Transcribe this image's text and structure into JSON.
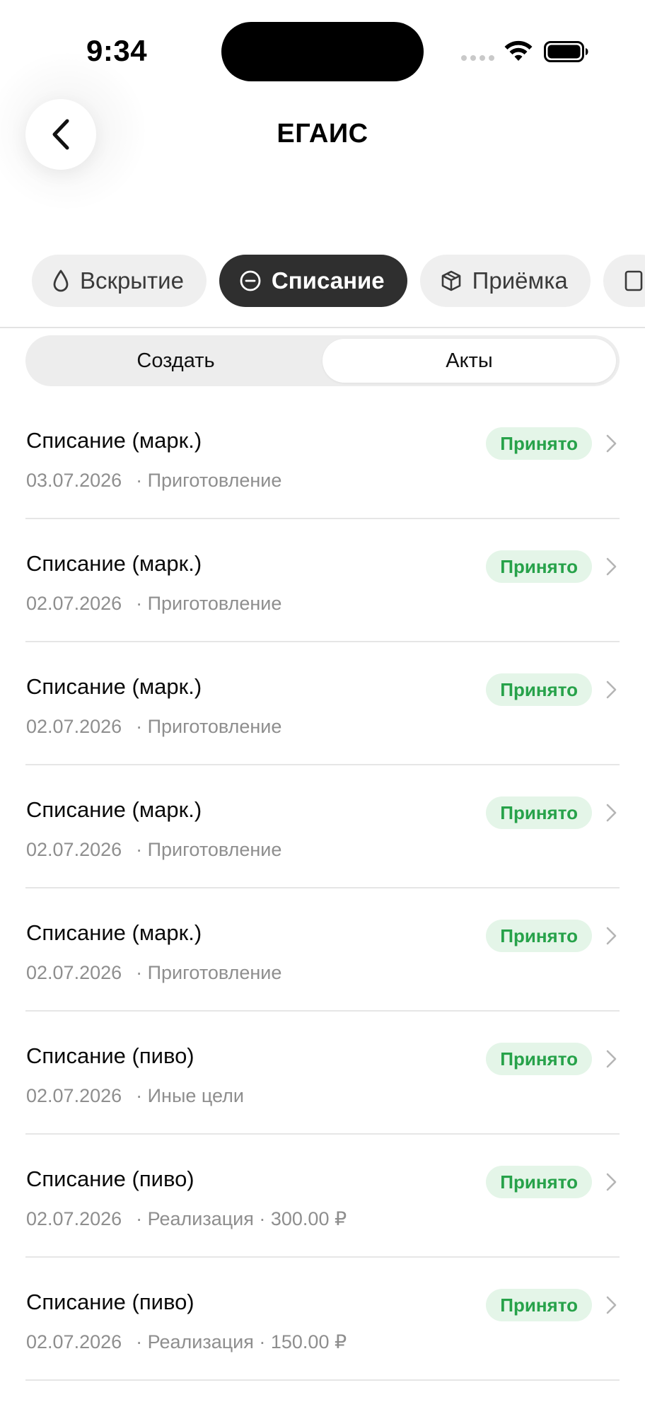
{
  "status_bar": {
    "time": "9:34"
  },
  "header": {
    "title": "ЕГАИС",
    "back_icon": "chevron-left-icon"
  },
  "categories": [
    {
      "label": "Вскрытие",
      "icon": "drop-icon",
      "active": false
    },
    {
      "label": "Списание",
      "icon": "minus-circle-icon",
      "active": true
    },
    {
      "label": "Приёмка",
      "icon": "box-icon",
      "active": false
    }
  ],
  "segments": {
    "create": "Создать",
    "acts": "Акты",
    "selected": "acts"
  },
  "colors": {
    "accent_dark": "#2f2f2f",
    "status_green": "#27a24a",
    "status_green_bg": "#e4f5e8"
  },
  "acts": [
    {
      "title": "Списание (марк.)",
      "date": "03.07.2026",
      "details": "· Приготовление",
      "status": "Принято"
    },
    {
      "title": "Списание (марк.)",
      "date": "02.07.2026",
      "details": "· Приготовление",
      "status": "Принято"
    },
    {
      "title": "Списание (марк.)",
      "date": "02.07.2026",
      "details": "· Приготовление",
      "status": "Принято"
    },
    {
      "title": "Списание (марк.)",
      "date": "02.07.2026",
      "details": "· Приготовление",
      "status": "Принято"
    },
    {
      "title": "Списание (марк.)",
      "date": "02.07.2026",
      "details": "· Приготовление",
      "status": "Принято"
    },
    {
      "title": "Списание (пиво)",
      "date": "02.07.2026",
      "details": "· Иные цели",
      "status": "Принято"
    },
    {
      "title": "Списание (пиво)",
      "date": "02.07.2026",
      "details": "· Реализация · 300.00 ₽",
      "status": "Принято"
    },
    {
      "title": "Списание (пиво)",
      "date": "02.07.2026",
      "details": "· Реализация · 150.00 ₽",
      "status": "Принято"
    }
  ]
}
